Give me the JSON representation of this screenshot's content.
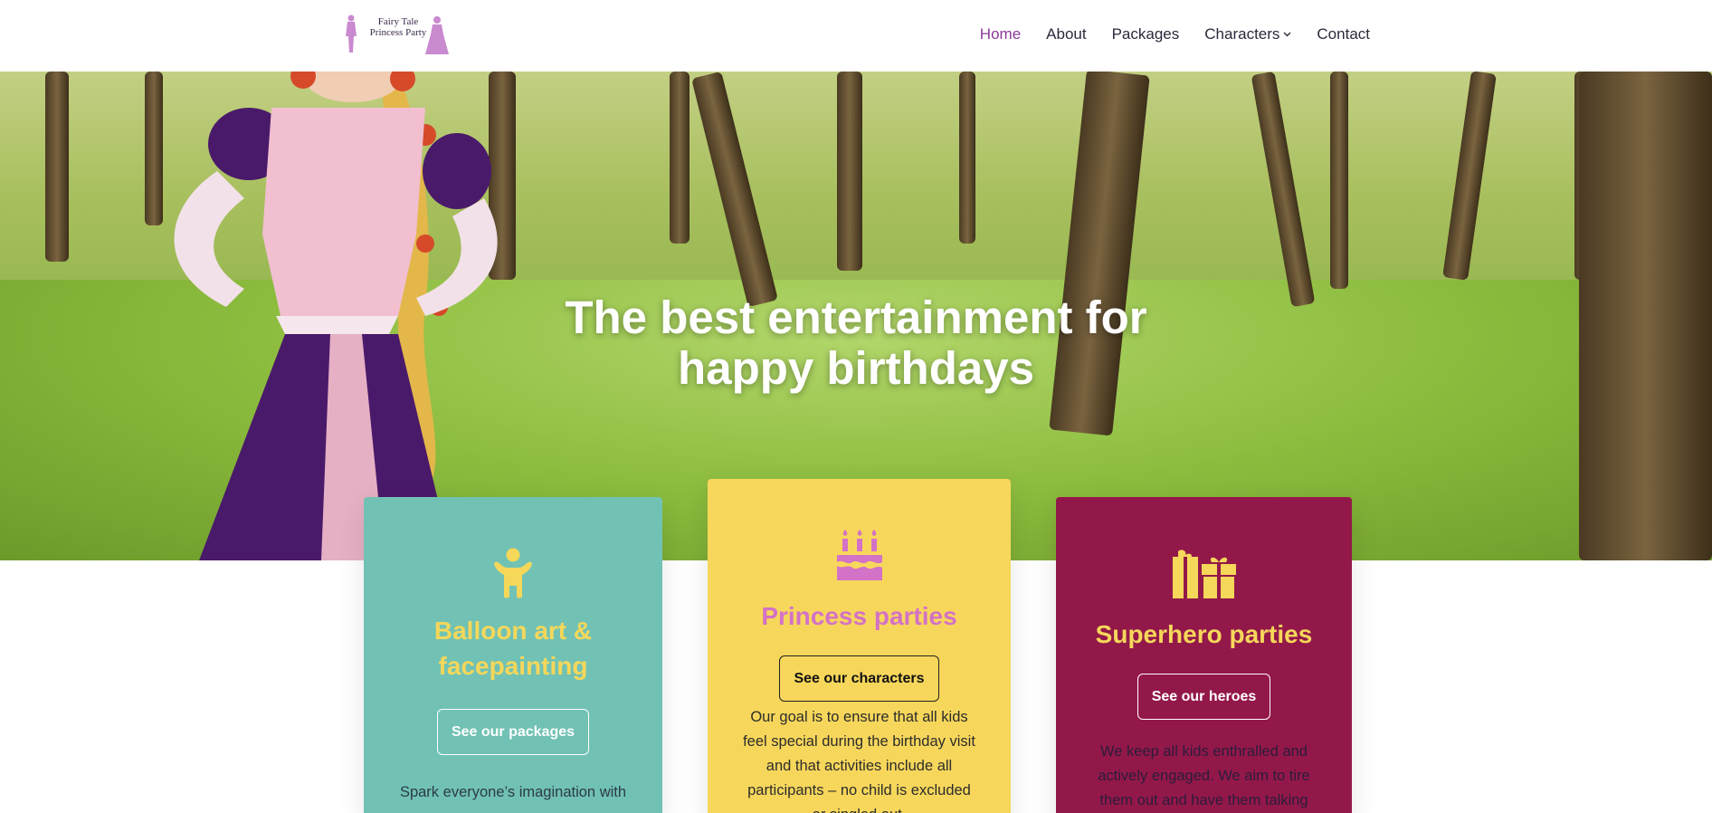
{
  "header": {
    "logo_text_line1": "Fairy Tale",
    "logo_text_line2": "Princess Party",
    "nav": [
      {
        "label": "Home",
        "active": true
      },
      {
        "label": "About"
      },
      {
        "label": "Packages"
      },
      {
        "label": "Characters",
        "has_dropdown": true
      },
      {
        "label": "Contact"
      }
    ]
  },
  "hero": {
    "title_line1": "The best entertainment for",
    "title_line2": "happy birthdays"
  },
  "cards": [
    {
      "icon": "child-icon",
      "title_line1": "Balloon art &",
      "title_line2": "facepainting",
      "button": "See our packages",
      "text": "Spark everyone’s imagination with"
    },
    {
      "icon": "birthday-cake-icon",
      "title": "Princess parties",
      "button": "See our characters",
      "text": "Our goal is to ensure that all kids feel special during the birthday visit and that activities include all participants – no child is excluded or singled out."
    },
    {
      "icon": "gift-icon",
      "title": "Superhero parties",
      "button": "See our heroes",
      "text": "We keep all kids enthralled and actively engaged. We aim to tire them out and have them talking"
    }
  ],
  "colors": {
    "teal": "#71c2b4",
    "yellow": "#f7d75b",
    "magenta": "#93184a",
    "pink": "#d372c6",
    "nav_active": "#8a3a9a"
  }
}
